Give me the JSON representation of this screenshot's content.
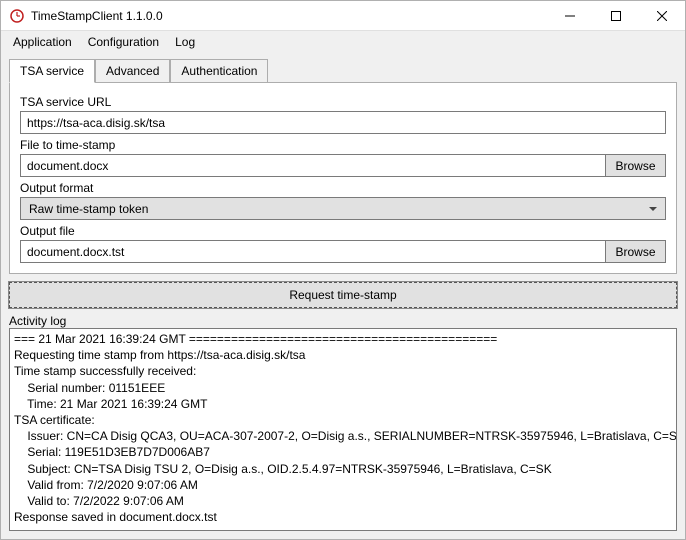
{
  "window": {
    "title": "TimeStampClient 1.1.0.0"
  },
  "menu": {
    "items": [
      "Application",
      "Configuration",
      "Log"
    ]
  },
  "tabs": {
    "items": [
      "TSA service",
      "Advanced",
      "Authentication"
    ],
    "active_index": 0
  },
  "form": {
    "tsa_url_label": "TSA service URL",
    "tsa_url_value": "https://tsa-aca.disig.sk/tsa",
    "file_label": "File to time-stamp",
    "file_value": "document.docx",
    "browse_label": "Browse",
    "format_label": "Output format",
    "format_value": "Raw time-stamp token",
    "output_label": "Output file",
    "output_value": "document.docx.tst"
  },
  "request_button_label": "Request time-stamp",
  "activity_label": "Activity log",
  "activity_log": "=== 21 Mar 2021 16:39:24 GMT ============================================\nRequesting time stamp from https://tsa-aca.disig.sk/tsa\nTime stamp successfully received:\n    Serial number: 01151EEE\n    Time: 21 Mar 2021 16:39:24 GMT\nTSA certificate:\n    Issuer: CN=CA Disig QCA3, OU=ACA-307-2007-2, O=Disig a.s., SERIALNUMBER=NTRSK-35975946, L=Bratislava, C=SK\n    Serial: 119E51D3EB7D7D006AB7\n    Subject: CN=TSA Disig TSU 2, O=Disig a.s., OID.2.5.4.97=NTRSK-35975946, L=Bratislava, C=SK\n    Valid from: 7/2/2020 9:07:06 AM\n    Valid to: 7/2/2022 9:07:06 AM\nResponse saved in document.docx.tst"
}
